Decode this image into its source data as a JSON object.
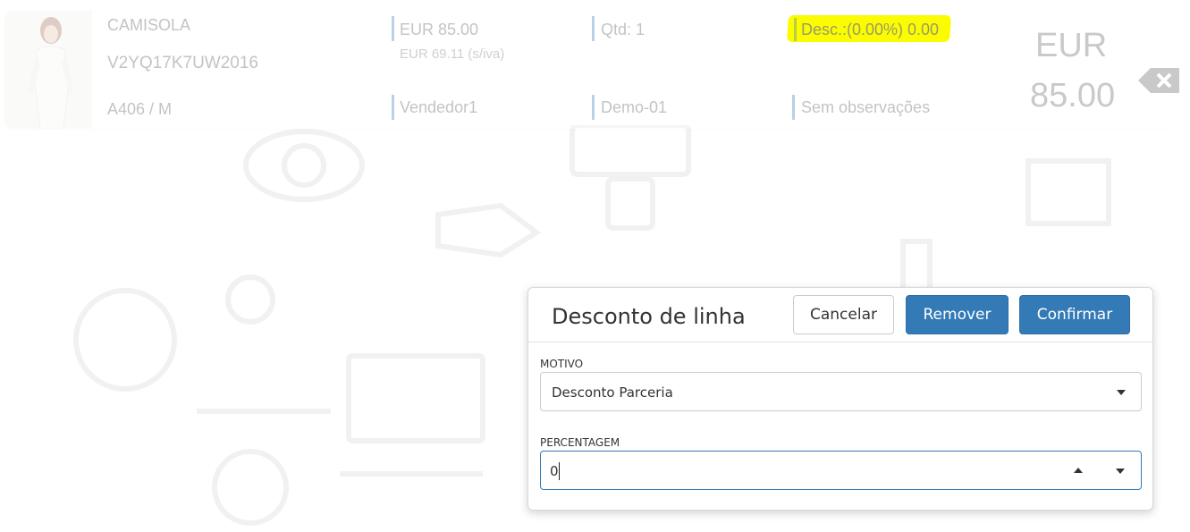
{
  "line_item": {
    "name": "CAMISOLA",
    "reference": "V2YQ17K7UW2016",
    "variant": "A406 / M",
    "price": "EUR 85.00",
    "price_no_vat": "EUR 69.11 (s/iva)",
    "quantity": "Qtd: 1",
    "discount": "Desc.:(0.00%) 0.00",
    "seller": "Vendedor1",
    "store": "Demo-01",
    "notes": "Sem observações",
    "total_currency": "EUR",
    "total_value": "85.00"
  },
  "modal": {
    "title": "Desconto de linha",
    "cancel_label": "Cancelar",
    "remove_label": "Remover",
    "confirm_label": "Confirmar",
    "motivo_label": "MOTIVO",
    "motivo_value": "Desconto Parceria",
    "percentagem_label": "PERCENTAGEM",
    "percentagem_value": "0"
  },
  "colors": {
    "primary": "#337ab7",
    "highlight": "#fcfc00",
    "separator": "#3a7ab8"
  }
}
